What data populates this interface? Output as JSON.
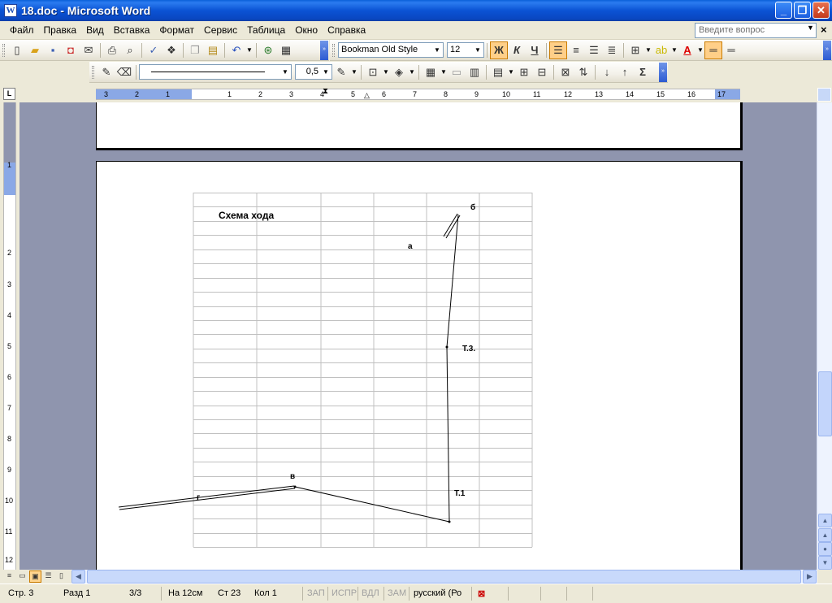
{
  "window": {
    "app_icon": "W",
    "title": "18.doc - Microsoft Word",
    "minimize": "_",
    "maximize": "❐",
    "close": "✕"
  },
  "menu": {
    "items": [
      "Файл",
      "Правка",
      "Вид",
      "Вставка",
      "Формат",
      "Сервис",
      "Таблица",
      "Окно",
      "Справка"
    ],
    "help_placeholder": "Введите вопрос",
    "close_doc": "×"
  },
  "formatting": {
    "font_name": "Bookman Old Style",
    "font_size": "12",
    "bold": "Ж",
    "italic": "К",
    "underline": "Ч",
    "sigma": "Σ",
    "line_weight": "0,5"
  },
  "ruler": {
    "h_labels": [
      "3",
      "2",
      "1",
      "1",
      "2",
      "3",
      "4",
      "5",
      "6",
      "7",
      "8",
      "9",
      "10",
      "11",
      "12",
      "13",
      "14",
      "15",
      "16",
      "17"
    ],
    "v_labels": [
      "1",
      "2",
      "3",
      "4",
      "5",
      "6",
      "7",
      "8",
      "9",
      "10",
      "11",
      "12"
    ],
    "tab_selector": "L"
  },
  "document": {
    "scheme_title": "Схема хода",
    "point_labels": {
      "a": "а",
      "b": "б",
      "v": "в",
      "g": "г",
      "t3": "Т.3.",
      "t1": "Т.1"
    }
  },
  "status": {
    "page": "Стр.  3",
    "section": "Разд  1",
    "pages": "3/3",
    "at": "На 12см",
    "line": "Ст  23",
    "column": "Кол  1",
    "rec": "ЗАП",
    "trk": "ИСПР",
    "ext": "ВДЛ",
    "ovr": "ЗАМ",
    "language": "русский (Ро"
  },
  "colors": {
    "titlebar": "#0b53d4",
    "workspace": "#8f95ae",
    "ruler_margin": "#8aa8e6",
    "active_button": "#ffcf88"
  }
}
